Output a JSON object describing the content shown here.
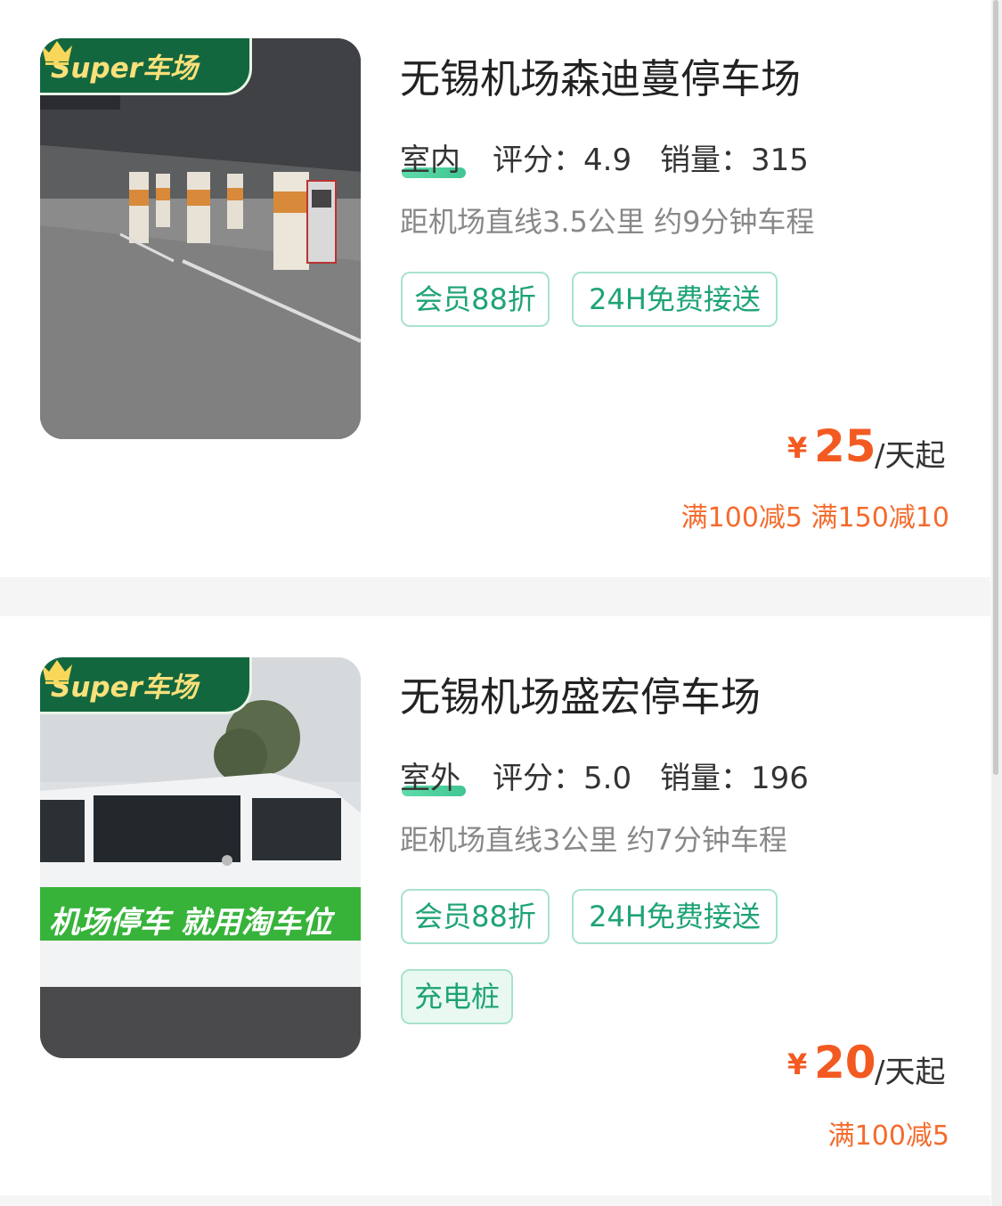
{
  "colors": {
    "accent_green": "#1ea474",
    "price_orange": "#f35a21",
    "badge_green": "#13673f",
    "badge_gold": "#f9e07a"
  },
  "lots": [
    {
      "badge": "Super车场",
      "image": "indoor-parking-garage-photo",
      "name": "无锡机场森迪蔓停车场",
      "type": "室内",
      "rating": "评分：4.9",
      "sales": "销量：315",
      "distance": "距机场直线3.5公里 约9分钟车程",
      "tags": [
        "会员88折",
        "24H免费接送"
      ],
      "currency": "¥",
      "price": "25",
      "unit": "/天起",
      "discount": "满100减5 满150减10"
    },
    {
      "badge": "Super车场",
      "image": "shuttle-van-photo",
      "image_banner_text": "机场停车 就用淘车位",
      "name": "无锡机场盛宏停车场",
      "type": "室外",
      "rating": "评分：5.0",
      "sales": "销量：196",
      "distance": "距机场直线3公里 约7分钟车程",
      "tags": [
        "会员88折",
        "24H免费接送",
        "充电桩"
      ],
      "currency": "¥",
      "price": "20",
      "unit": "/天起",
      "discount": "满100减5"
    }
  ]
}
